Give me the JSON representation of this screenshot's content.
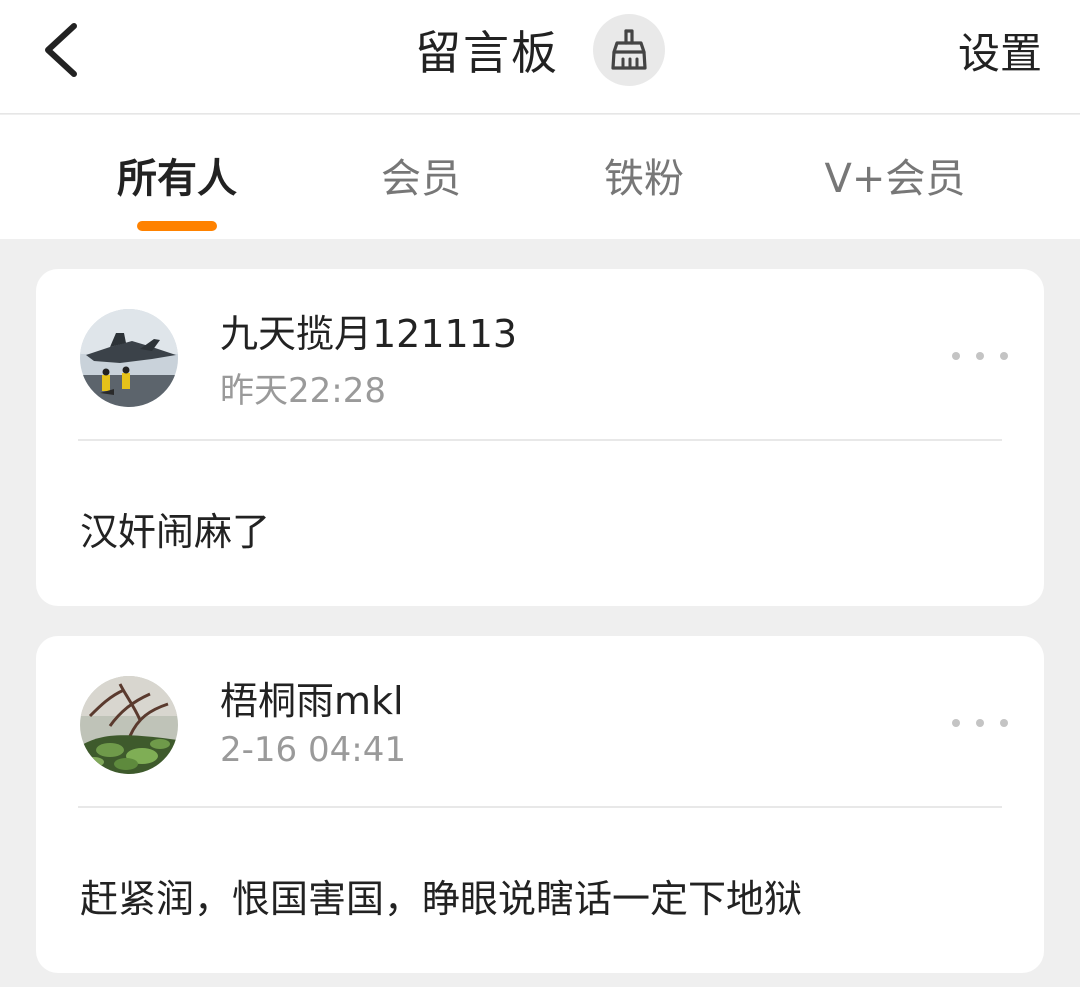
{
  "header": {
    "title": "留言板",
    "settings_label": "设置",
    "back_icon": "chevron-left-icon",
    "clean_icon": "broom-icon"
  },
  "tabs": [
    {
      "label": "所有人",
      "active": true
    },
    {
      "label": "会员",
      "active": false
    },
    {
      "label": "铁粉",
      "active": false
    },
    {
      "label": "V+会员",
      "active": false
    }
  ],
  "colors": {
    "accent": "#ff8200",
    "background": "#efefef",
    "card": "#ffffff",
    "secondary_text": "#9a9a9a"
  },
  "messages": [
    {
      "username": "九天揽月121113",
      "time": "昨天22:28",
      "content": "汉奸闹麻了",
      "avatar": "fighter-jet-photo",
      "more_icon": "more-dots-icon"
    },
    {
      "username": "梧桐雨mkl",
      "time": "2-16 04:41",
      "content": "赶紧润，恨国害国，睁眼说瞎话一定下地狱",
      "avatar": "plant-photo",
      "more_icon": "more-dots-icon"
    }
  ]
}
